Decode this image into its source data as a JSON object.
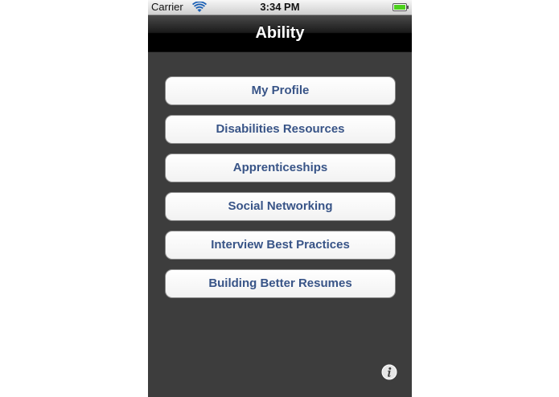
{
  "status_bar": {
    "carrier": "Carrier",
    "time": "3:34 PM",
    "wifi_icon": "wifi-icon",
    "battery_icon": "battery-icon"
  },
  "nav_bar": {
    "title": "Ability"
  },
  "menu": {
    "items": [
      {
        "label": "My Profile"
      },
      {
        "label": "Disabilities Resources"
      },
      {
        "label": "Apprenticeships"
      },
      {
        "label": "Social Networking"
      },
      {
        "label": "Interview Best Practices"
      },
      {
        "label": "Building Better Resumes"
      }
    ]
  },
  "info_button": {
    "icon": "info-icon"
  },
  "colors": {
    "button_text": "#385487",
    "background": "#3d3d3d",
    "battery": "#4cd11c"
  }
}
